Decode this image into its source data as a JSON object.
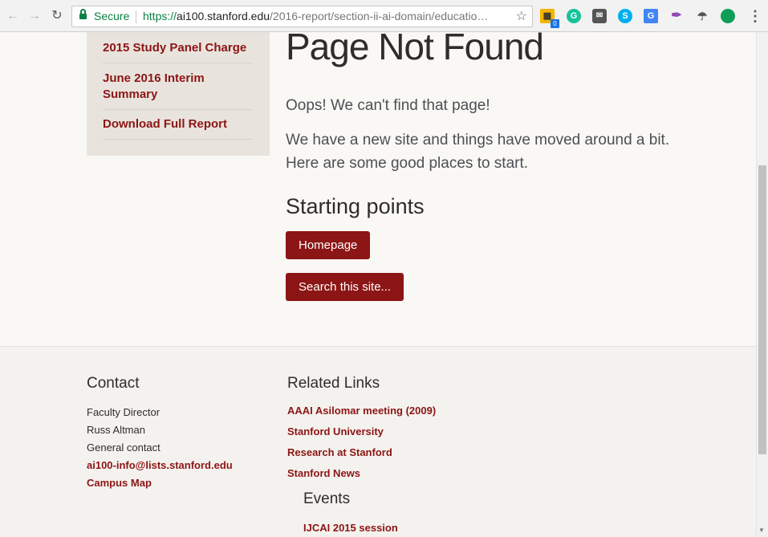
{
  "browser": {
    "secure_label": "Secure",
    "url_scheme": "https://",
    "url_host": "ai100.stanford.edu",
    "url_path": "/2016-report/section-ii-ai-domain/educatio…",
    "badge_count": "0"
  },
  "sidebar": {
    "items": [
      {
        "label": "2015 Study Panel Charge"
      },
      {
        "label": "June 2016 Interim Summary"
      },
      {
        "label": "Download Full Report"
      }
    ]
  },
  "main": {
    "title": "Page Not Found",
    "oops": "Oops! We can't find that page!",
    "moved_line1": "We have a new site and things have moved around a bit.",
    "moved_line2": "Here are some good places to start.",
    "starting_points": "Starting points",
    "homepage_button": "Homepage",
    "search_button": "Search this site..."
  },
  "footer": {
    "contact": {
      "heading": "Contact",
      "faculty_label": "Faculty Director",
      "faculty_name": "Russ Altman",
      "general_label": "General contact",
      "email": "ai100-info@lists.stanford.edu",
      "map": "Campus Map"
    },
    "related": {
      "heading": "Related Links",
      "links": [
        {
          "label": "AAAI Asilomar meeting (2009)"
        },
        {
          "label": "Stanford University"
        },
        {
          "label": "Research at Stanford"
        },
        {
          "label": "Stanford News"
        }
      ]
    },
    "events": {
      "heading": "Events",
      "links": [
        {
          "label": "IJCAI 2015 session"
        }
      ]
    }
  },
  "colors": {
    "cardinal": "#8c1515",
    "sidebar_bg": "#e8e4dd",
    "page_bg": "#f9f8f5"
  }
}
